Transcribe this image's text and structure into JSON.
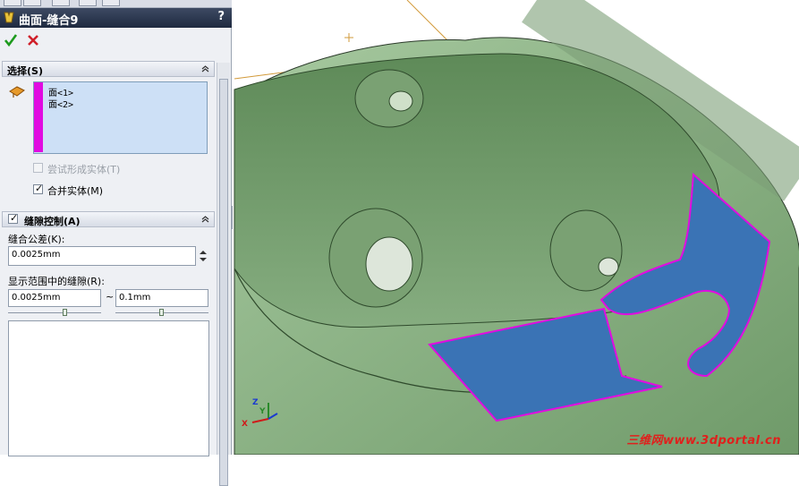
{
  "property_manager": {
    "title": "曲面-缝合9",
    "help_label": "?",
    "ok_icon": "check-icon",
    "cancel_icon": "close-icon",
    "accent_color": "#e10be1"
  },
  "selection": {
    "heading": "选择(S)",
    "items": [
      "面<1>",
      "面<2>"
    ],
    "try_form_solid": {
      "label": "尝试形成实体(T)",
      "checked": false,
      "enabled": false
    },
    "merge_entities": {
      "label": "合并实体(M)",
      "checked": true,
      "enabled": true
    }
  },
  "gap_control": {
    "heading": "缝隙控制(A)",
    "enabled": true,
    "tolerance_label": "缝合公差(K):",
    "tolerance_value": "0.0025mm",
    "range_label": "显示范围中的缝隙(R):",
    "range_min": "0.0025mm",
    "range_separator": "~",
    "range_max": "0.1mm"
  },
  "viewport": {
    "model_color": "#8fb889",
    "highlight_surface_color": "#3a73b5",
    "selection_edge_color": "#e10be1"
  },
  "triad": {
    "z": "Z",
    "y": "Y",
    "x": "X"
  },
  "watermark": "三维网www.3dportal.cn"
}
